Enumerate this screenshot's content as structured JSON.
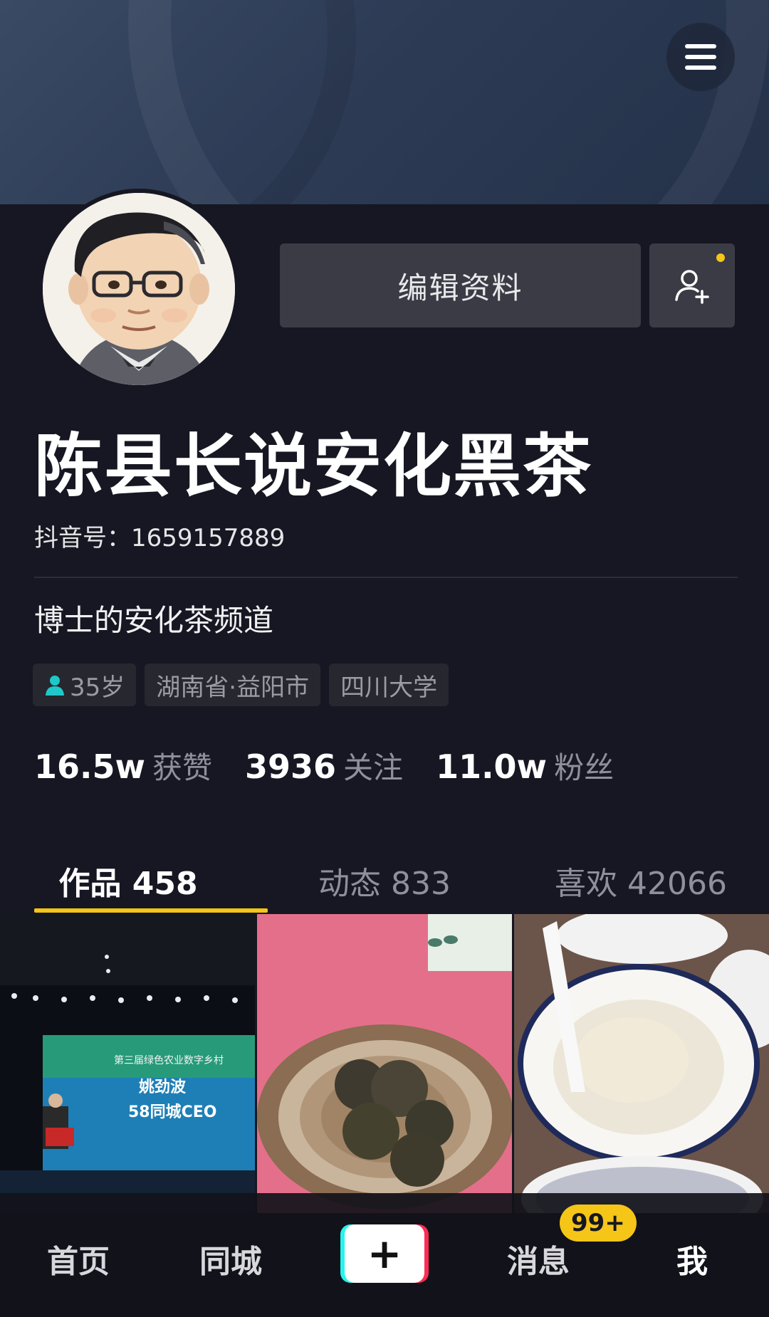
{
  "profile": {
    "edit_label": "编辑资料",
    "nickname": "陈县长说安化黑茶",
    "douyin_id": "抖音号：1659157889",
    "bio": "博士的安化茶频道",
    "tags": [
      "35岁",
      "湖南省·益阳市",
      "四川大学"
    ]
  },
  "stats": [
    {
      "value": "16.5w",
      "label": "获赞"
    },
    {
      "value": "3936",
      "label": "关注"
    },
    {
      "value": "11.0w",
      "label": "粉丝"
    }
  ],
  "tabs": [
    "作品 458",
    "动态 833",
    "喜欢 42066"
  ],
  "videos": [
    {
      "overlay_text": "姚劲波",
      "overlay_sub": "58同城CEO",
      "banner_text": "第三届绿色农业数字乡村"
    },
    {},
    {}
  ],
  "bottom_nav": {
    "home": "首页",
    "city": "同城",
    "create": "+",
    "messages": "消息",
    "messages_badge": "99+",
    "me": "我"
  },
  "colors": {
    "background": "#161722",
    "accent_yellow": "#f5c518",
    "cyan": "#25f4ee",
    "red": "#fe2c55"
  }
}
